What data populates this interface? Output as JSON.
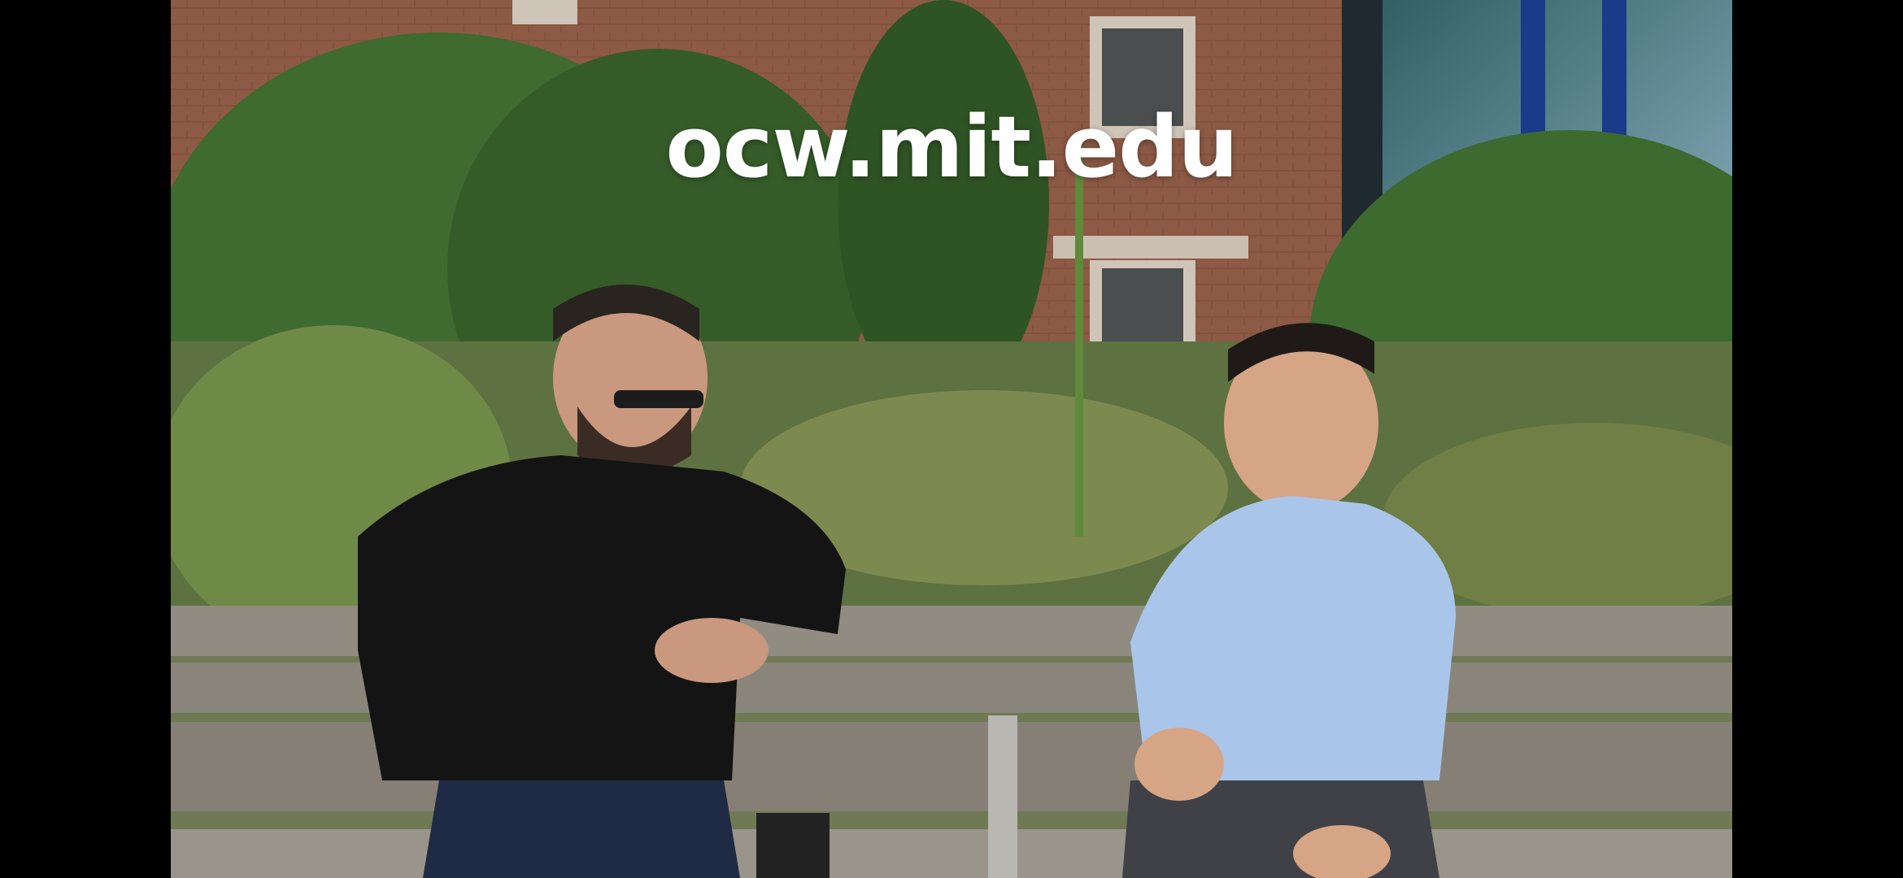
{
  "video": {
    "watermark_text": "ocw.mit.edu",
    "letterbox_color": "#000000",
    "scene": "outdoor-interview-bench"
  }
}
